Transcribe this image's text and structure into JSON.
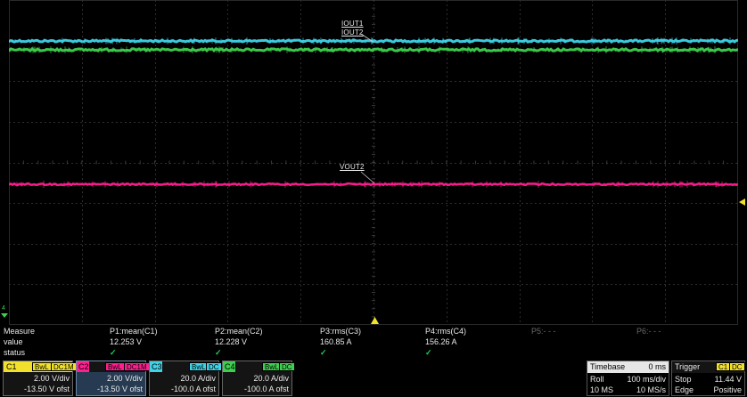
{
  "traces": {
    "iout1_label": "IOUT1",
    "iout2_label": "IOUT2",
    "vout2_label": "VOUT2",
    "colors": {
      "c1": "#f1e12c",
      "c2": "#ff1f8f",
      "c3": "#3fd3e8",
      "c4": "#3fcf4f"
    }
  },
  "ground_marker": "4",
  "measure": {
    "row_labels": [
      "Measure",
      "value",
      "status"
    ],
    "params": [
      {
        "name": "P1:mean(C1)",
        "value": "12.253 V",
        "status": "✓"
      },
      {
        "name": "P2:mean(C2)",
        "value": "12.228 V",
        "status": "✓"
      },
      {
        "name": "P3:rms(C3)",
        "value": "160.85 A",
        "status": "✓"
      },
      {
        "name": "P4:rms(C4)",
        "value": "156.26 A",
        "status": "✓"
      },
      {
        "name": "P5:- - -",
        "value": "",
        "status": ""
      },
      {
        "name": "P6:- - -",
        "value": "",
        "status": ""
      }
    ]
  },
  "channels": [
    {
      "name": "C1",
      "badges": [
        "BwL",
        "DC1M"
      ],
      "vdiv": "2.00 V/div",
      "offset": "-13.50 V ofst"
    },
    {
      "name": "C2",
      "badges": [
        "BwL",
        "DC1M"
      ],
      "vdiv": "2.00 V/div",
      "offset": "-13.50 V ofst"
    },
    {
      "name": "C3",
      "badges": [
        "BwL",
        "DC"
      ],
      "vdiv": "20.0 A/div",
      "offset": "-100.0 A ofst"
    },
    {
      "name": "C4",
      "badges": [
        "BwL",
        "DC"
      ],
      "vdiv": "20.0 A/div",
      "offset": "-100.0 A ofst"
    }
  ],
  "timebase": {
    "title": "Timebase",
    "delay": "0 ms",
    "mode": "Roll",
    "tdiv": "100 ms/div",
    "samples": "10 MS",
    "rate": "10 MS/s"
  },
  "trigger": {
    "title": "Trigger",
    "source_badge": "C1",
    "coupling_badge": "DC",
    "state": "Stop",
    "level": "11.44 V",
    "type": "Edge",
    "slope": "Positive"
  }
}
